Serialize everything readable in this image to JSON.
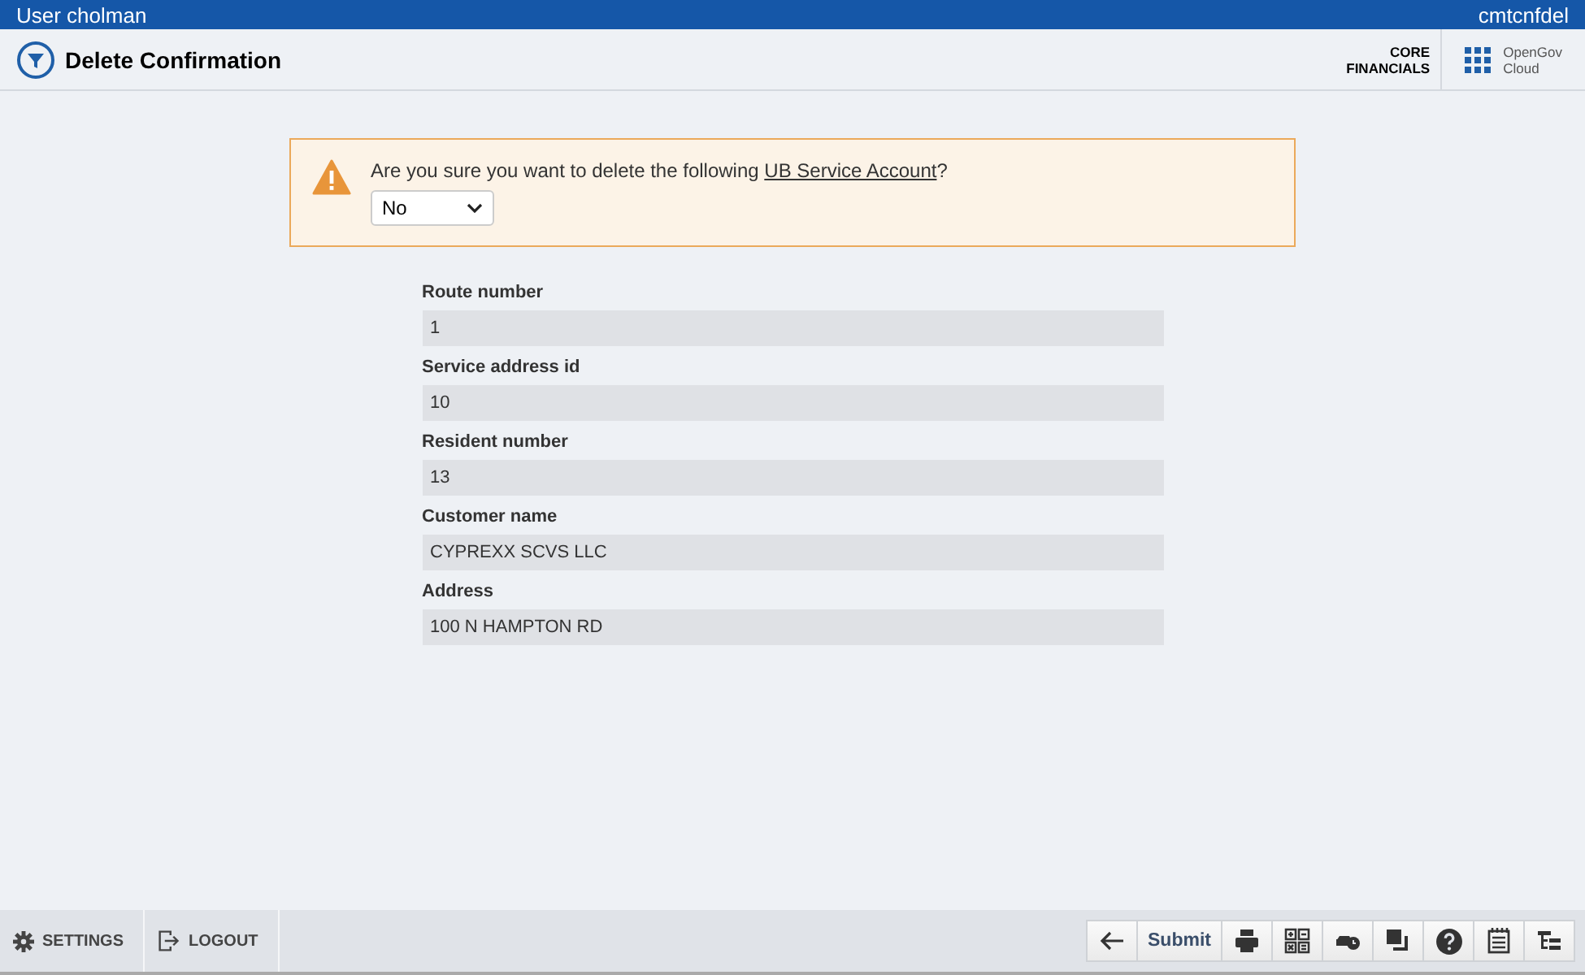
{
  "top_bar": {
    "user": "User cholman",
    "database": "cmtcnfdel"
  },
  "header": {
    "title": "Delete Confirmation",
    "product": [
      "CORE",
      "FINANCIALS"
    ],
    "brand": [
      "OpenGov",
      "Cloud"
    ]
  },
  "warning": {
    "text_before": "Are you sure you want to delete the following ",
    "link": "UB Service Account",
    "text_after": "?",
    "select_value": "No"
  },
  "fields": [
    {
      "label": "Route number",
      "value": "1"
    },
    {
      "label": "Service address id",
      "value": "10"
    },
    {
      "label": "Resident number",
      "value": "13"
    },
    {
      "label": "Customer name",
      "value": "CYPREXX SCVS LLC"
    },
    {
      "label": "Address",
      "value": "100 N HAMPTON RD"
    }
  ],
  "footer": {
    "settings": "SETTINGS",
    "logout": "LOGOUT",
    "submit": "Submit"
  }
}
